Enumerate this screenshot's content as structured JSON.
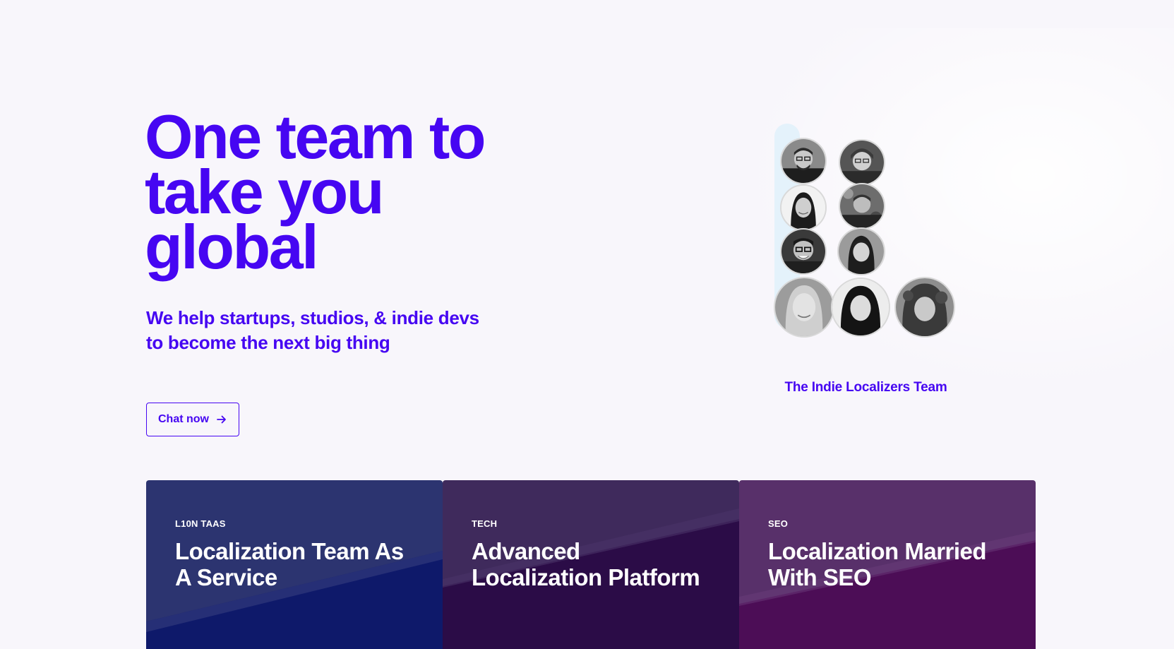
{
  "hero": {
    "title_lines": [
      "One team to",
      "take you",
      "global"
    ],
    "subtitle": "We help startups, studios, & indie devs to become the next big thing",
    "cta_label": "Chat now",
    "cta_icon": "arrow-right-icon"
  },
  "team": {
    "caption": "The Indie Localizers Team",
    "member_count": 9
  },
  "cards": [
    {
      "tag": "L10N TAAS",
      "title": "Localization Team As A Service"
    },
    {
      "tag": "TECH",
      "title": "Advanced Localization Platform"
    },
    {
      "tag": "SEO",
      "title": "Localization Married With SEO"
    }
  ],
  "colors": {
    "brand": "#4606f2",
    "page_background": "#f8f6fb",
    "card_1": "#2c3470",
    "card_2": "#3f2a5c",
    "card_3": "#58306a"
  }
}
